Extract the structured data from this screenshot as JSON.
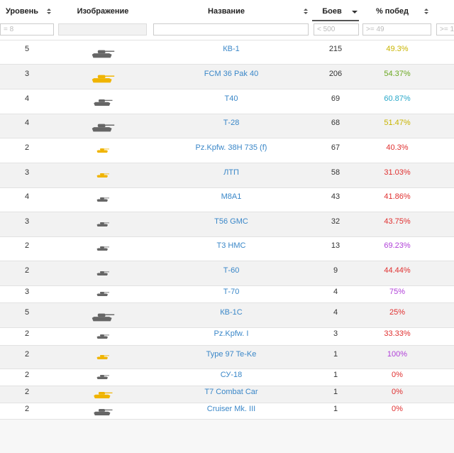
{
  "columns": [
    {
      "key": "level",
      "label": "Уровень"
    },
    {
      "key": "image",
      "label": "Изображение"
    },
    {
      "key": "name",
      "label": "Название"
    },
    {
      "key": "battles",
      "label": "Боев"
    },
    {
      "key": "winrate",
      "label": "% побед"
    }
  ],
  "filters": {
    "level_placeholder": "= 8",
    "battles_placeholder": "< 500",
    "winrate_placeholder": ">= 49",
    "extra_placeholder": ">= 1"
  },
  "colors": {
    "link": "#3a87c8",
    "tank_gray": "#666666",
    "tank_premium": "#f0b400"
  },
  "rows": [
    {
      "level": "5",
      "name": "КВ-1",
      "battles": "215",
      "winrate": "49.3%",
      "wr_color": "#c8b400",
      "icon": "tank-heavy-icon",
      "premium": false,
      "size": "lg"
    },
    {
      "level": "3",
      "name": "FCM 36 Pak 40",
      "battles": "206",
      "winrate": "54.37%",
      "wr_color": "#6aa820",
      "icon": "tank-destroyer-icon",
      "premium": true,
      "size": "lg"
    },
    {
      "level": "4",
      "name": "T40",
      "battles": "69",
      "winrate": "60.87%",
      "wr_color": "#29a8c9",
      "icon": "tank-destroyer-icon",
      "premium": false,
      "size": "md"
    },
    {
      "level": "4",
      "name": "Т-28",
      "battles": "68",
      "winrate": "51.47%",
      "wr_color": "#c8b400",
      "icon": "tank-medium-icon",
      "premium": false,
      "size": "lg"
    },
    {
      "level": "2",
      "name": "Pz.Kpfw. 38H 735 (f)",
      "battles": "67",
      "winrate": "40.3%",
      "wr_color": "#e03030",
      "icon": "tank-light-icon",
      "premium": true,
      "size": "sm"
    },
    {
      "level": "3",
      "name": "ЛТП",
      "battles": "58",
      "winrate": "31.03%",
      "wr_color": "#e03030",
      "icon": "tank-light-icon",
      "premium": true,
      "size": "sm"
    },
    {
      "level": "4",
      "name": "M8A1",
      "battles": "43",
      "winrate": "41.86%",
      "wr_color": "#e03030",
      "icon": "tank-destroyer-icon",
      "premium": false,
      "size": "sm"
    },
    {
      "level": "3",
      "name": "T56 GMC",
      "battles": "32",
      "winrate": "43.75%",
      "wr_color": "#e03030",
      "icon": "spg-icon",
      "premium": false,
      "size": "sm"
    },
    {
      "level": "2",
      "name": "T3 HMC",
      "battles": "13",
      "winrate": "69.23%",
      "wr_color": "#b040d8",
      "icon": "spg-icon",
      "premium": false,
      "size": "sm"
    },
    {
      "level": "2",
      "name": "Т-60",
      "battles": "9",
      "winrate": "44.44%",
      "wr_color": "#e03030",
      "icon": "tank-light-icon",
      "premium": false,
      "size": "sm"
    },
    {
      "level": "3",
      "name": "Т-70",
      "battles": "4",
      "winrate": "75%",
      "wr_color": "#b040d8",
      "icon": "tank-light-icon",
      "premium": false,
      "size": "sm"
    },
    {
      "level": "5",
      "name": "КВ-1С",
      "battles": "4",
      "winrate": "25%",
      "wr_color": "#e03030",
      "icon": "tank-heavy-icon",
      "premium": false,
      "size": "lg"
    },
    {
      "level": "2",
      "name": "Pz.Kpfw. I",
      "battles": "3",
      "winrate": "33.33%",
      "wr_color": "#e03030",
      "icon": "tank-light-icon",
      "premium": false,
      "size": "sm"
    },
    {
      "level": "2",
      "name": "Type 97 Te-Ke",
      "battles": "1",
      "winrate": "100%",
      "wr_color": "#b040d8",
      "icon": "tank-light-icon",
      "premium": true,
      "size": "sm"
    },
    {
      "level": "2",
      "name": "СУ-18",
      "battles": "1",
      "winrate": "0%",
      "wr_color": "#e03030",
      "icon": "spg-icon",
      "premium": false,
      "size": "sm"
    },
    {
      "level": "2",
      "name": "T7 Combat Car",
      "battles": "1",
      "winrate": "0%",
      "wr_color": "#e03030",
      "icon": "tank-light-icon",
      "premium": true,
      "size": "md"
    },
    {
      "level": "2",
      "name": "Cruiser Mk. III",
      "battles": "1",
      "winrate": "0%",
      "wr_color": "#e03030",
      "icon": "tank-light-icon",
      "premium": false,
      "size": "md"
    }
  ]
}
